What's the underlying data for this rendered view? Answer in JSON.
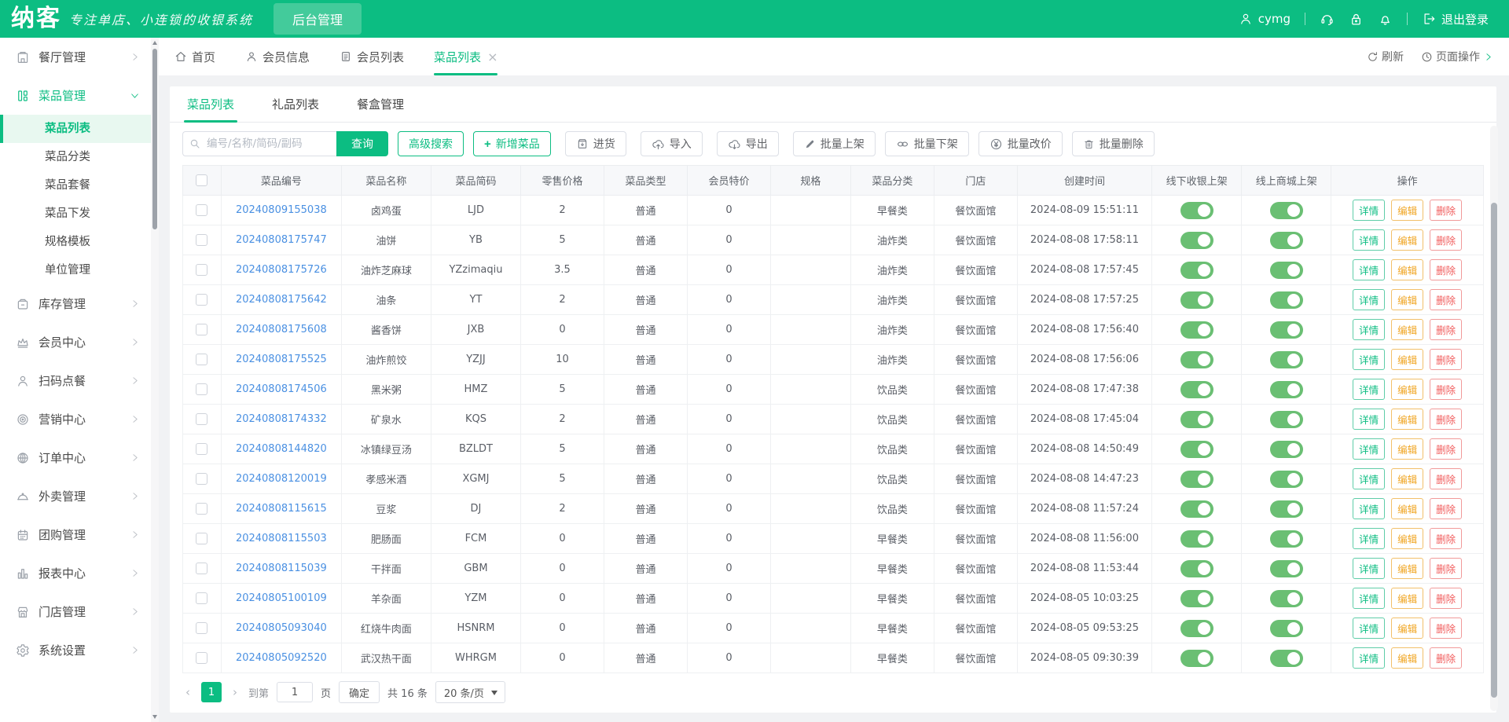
{
  "colors": {
    "accent_green": "#0cbd82",
    "toggle_green": "#6abf73",
    "link_blue": "#4a90e2",
    "edit_orange": "#f0a522",
    "delete_red": "#f15b5b"
  },
  "header": {
    "logo": "纳客",
    "slogan": "专注单店、小连锁的收银系统",
    "backstage": "后台管理",
    "username": "cymg",
    "logout": "退出登录"
  },
  "sidebar": {
    "items": [
      {
        "label": "餐厅管理",
        "icon": "restaurant",
        "expanded": false
      },
      {
        "label": "菜品管理",
        "icon": "dishes",
        "expanded": true,
        "children": [
          "菜品列表",
          "菜品分类",
          "菜品套餐",
          "菜品下发",
          "规格模板",
          "单位管理"
        ],
        "active_child": 0
      },
      {
        "label": "库存管理",
        "icon": "inventory",
        "expanded": false
      },
      {
        "label": "会员中心",
        "icon": "crown",
        "expanded": false
      },
      {
        "label": "扫码点餐",
        "icon": "person",
        "expanded": false
      },
      {
        "label": "营销中心",
        "icon": "target",
        "expanded": false
      },
      {
        "label": "订单中心",
        "icon": "globe",
        "expanded": false
      },
      {
        "label": "外卖管理",
        "icon": "cloche",
        "expanded": false
      },
      {
        "label": "团购管理",
        "icon": "calendar",
        "expanded": false
      },
      {
        "label": "报表中心",
        "icon": "chart",
        "expanded": false
      },
      {
        "label": "门店管理",
        "icon": "store",
        "expanded": false
      },
      {
        "label": "系统设置",
        "icon": "gear",
        "expanded": false
      }
    ]
  },
  "tabbar": {
    "tabs": [
      {
        "label": "首页"
      },
      {
        "label": "会员信息"
      },
      {
        "label": "会员列表"
      },
      {
        "label": "菜品列表",
        "active": true
      }
    ],
    "refresh": "刷新",
    "page_ops": "页面操作"
  },
  "content": {
    "subtabs": [
      "菜品列表",
      "礼品列表",
      "餐盒管理"
    ],
    "toolbar": {
      "search_placeholder": "编号/名称/简码/副码",
      "query": "查询",
      "advanced_search": "高级搜索",
      "add_plus": "+",
      "add_dish": "新增菜品",
      "purchase": "进货",
      "import": "导入",
      "export": "导出",
      "batch_on": "批量上架",
      "batch_off": "批量下架",
      "batch_price": "批量改价",
      "batch_delete": "批量删除"
    },
    "table": {
      "headers": [
        "菜品编号",
        "菜品名称",
        "菜品简码",
        "零售价格",
        "菜品类型",
        "会员特价",
        "规格",
        "菜品分类",
        "门店",
        "创建时间",
        "线下收银上架",
        "线上商城上架",
        "操作"
      ],
      "action_labels": [
        "详情",
        "编辑",
        "删除"
      ],
      "rows": [
        {
          "code": "20240809155038",
          "name": "卤鸡蛋",
          "short": "LJD",
          "price": "2",
          "type": "普通",
          "member_price": "0",
          "spec": "",
          "category": "早餐类",
          "store": "餐饮面馆",
          "created": "2024-08-09 15:51:11",
          "pos_on": true,
          "mall_on": true
        },
        {
          "code": "20240808175747",
          "name": "油饼",
          "short": "YB",
          "price": "5",
          "type": "普通",
          "member_price": "0",
          "spec": "",
          "category": "油炸类",
          "store": "餐饮面馆",
          "created": "2024-08-08 17:58:11",
          "pos_on": true,
          "mall_on": true
        },
        {
          "code": "20240808175726",
          "name": "油炸芝麻球",
          "short": "YZzimaqiu",
          "price": "3.5",
          "type": "普通",
          "member_price": "0",
          "spec": "",
          "category": "油炸类",
          "store": "餐饮面馆",
          "created": "2024-08-08 17:57:45",
          "pos_on": true,
          "mall_on": true
        },
        {
          "code": "20240808175642",
          "name": "油条",
          "short": "YT",
          "price": "2",
          "type": "普通",
          "member_price": "0",
          "spec": "",
          "category": "油炸类",
          "store": "餐饮面馆",
          "created": "2024-08-08 17:57:25",
          "pos_on": true,
          "mall_on": true
        },
        {
          "code": "20240808175608",
          "name": "酱香饼",
          "short": "JXB",
          "price": "0",
          "type": "普通",
          "member_price": "0",
          "spec": "",
          "category": "油炸类",
          "store": "餐饮面馆",
          "created": "2024-08-08 17:56:40",
          "pos_on": true,
          "mall_on": true
        },
        {
          "code": "20240808175525",
          "name": "油炸煎饺",
          "short": "YZJJ",
          "price": "10",
          "type": "普通",
          "member_price": "0",
          "spec": "",
          "category": "油炸类",
          "store": "餐饮面馆",
          "created": "2024-08-08 17:56:06",
          "pos_on": true,
          "mall_on": true
        },
        {
          "code": "20240808174506",
          "name": "黑米粥",
          "short": "HMZ",
          "price": "5",
          "type": "普通",
          "member_price": "0",
          "spec": "",
          "category": "饮品类",
          "store": "餐饮面馆",
          "created": "2024-08-08 17:47:38",
          "pos_on": true,
          "mall_on": true
        },
        {
          "code": "20240808174332",
          "name": "矿泉水",
          "short": "KQS",
          "price": "2",
          "type": "普通",
          "member_price": "0",
          "spec": "",
          "category": "饮品类",
          "store": "餐饮面馆",
          "created": "2024-08-08 17:45:04",
          "pos_on": true,
          "mall_on": true
        },
        {
          "code": "20240808144820",
          "name": "冰镇绿豆汤",
          "short": "BZLDT",
          "price": "5",
          "type": "普通",
          "member_price": "0",
          "spec": "",
          "category": "饮品类",
          "store": "餐饮面馆",
          "created": "2024-08-08 14:50:49",
          "pos_on": true,
          "mall_on": true
        },
        {
          "code": "20240808120019",
          "name": "孝感米酒",
          "short": "XGMJ",
          "price": "5",
          "type": "普通",
          "member_price": "0",
          "spec": "",
          "category": "饮品类",
          "store": "餐饮面馆",
          "created": "2024-08-08 14:47:23",
          "pos_on": true,
          "mall_on": true
        },
        {
          "code": "20240808115615",
          "name": "豆浆",
          "short": "DJ",
          "price": "2",
          "type": "普通",
          "member_price": "0",
          "spec": "",
          "category": "饮品类",
          "store": "餐饮面馆",
          "created": "2024-08-08 11:57:24",
          "pos_on": true,
          "mall_on": true
        },
        {
          "code": "20240808115503",
          "name": "肥肠面",
          "short": "FCM",
          "price": "0",
          "type": "普通",
          "member_price": "0",
          "spec": "",
          "category": "早餐类",
          "store": "餐饮面馆",
          "created": "2024-08-08 11:56:00",
          "pos_on": true,
          "mall_on": true
        },
        {
          "code": "20240808115039",
          "name": "干拌面",
          "short": "GBM",
          "price": "0",
          "type": "普通",
          "member_price": "0",
          "spec": "",
          "category": "早餐类",
          "store": "餐饮面馆",
          "created": "2024-08-08 11:53:44",
          "pos_on": true,
          "mall_on": true
        },
        {
          "code": "20240805100109",
          "name": "羊杂面",
          "short": "YZM",
          "price": "0",
          "type": "普通",
          "member_price": "0",
          "spec": "",
          "category": "早餐类",
          "store": "餐饮面馆",
          "created": "2024-08-05 10:03:25",
          "pos_on": true,
          "mall_on": true
        },
        {
          "code": "20240805093040",
          "name": "红烧牛肉面",
          "short": "HSNRM",
          "price": "0",
          "type": "普通",
          "member_price": "0",
          "spec": "",
          "category": "早餐类",
          "store": "餐饮面馆",
          "created": "2024-08-05 09:53:25",
          "pos_on": true,
          "mall_on": true
        },
        {
          "code": "20240805092520",
          "name": "武汉热干面",
          "short": "WHRGM",
          "price": "0",
          "type": "普通",
          "member_price": "0",
          "spec": "",
          "category": "早餐类",
          "store": "餐饮面馆",
          "created": "2024-08-05 09:30:39",
          "pos_on": true,
          "mall_on": true
        }
      ]
    },
    "pagination": {
      "current_page": "1",
      "goto_label": "到第",
      "page_input": "1",
      "page_suffix": "页",
      "confirm": "确定",
      "total": "共 16 条",
      "per_page": "20 条/页"
    }
  }
}
